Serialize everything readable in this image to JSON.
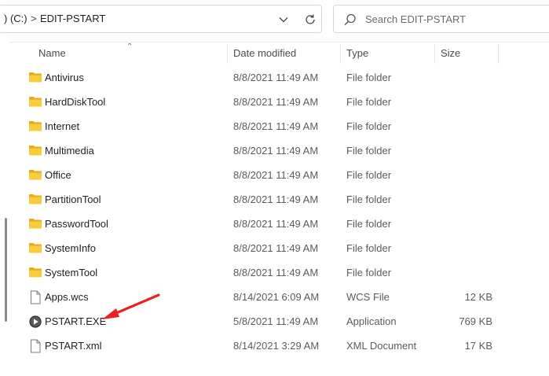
{
  "address": {
    "drive_label": ") (C:)",
    "separator": ">",
    "folder_label": "EDIT-PSTART"
  },
  "search": {
    "placeholder": "Search EDIT-PSTART"
  },
  "columns": {
    "name": "Name",
    "date": "Date modified",
    "type": "Type",
    "size": "Size"
  },
  "files": [
    {
      "name": "Antivirus",
      "date": "8/8/2021 11:49 AM",
      "type": "File folder",
      "size": "",
      "icon": "folder-icon"
    },
    {
      "name": "HardDiskTool",
      "date": "8/8/2021 11:49 AM",
      "type": "File folder",
      "size": "",
      "icon": "folder-icon"
    },
    {
      "name": "Internet",
      "date": "8/8/2021 11:49 AM",
      "type": "File folder",
      "size": "",
      "icon": "folder-icon"
    },
    {
      "name": "Multimedia",
      "date": "8/8/2021 11:49 AM",
      "type": "File folder",
      "size": "",
      "icon": "folder-icon"
    },
    {
      "name": "Office",
      "date": "8/8/2021 11:49 AM",
      "type": "File folder",
      "size": "",
      "icon": "folder-icon"
    },
    {
      "name": "PartitionTool",
      "date": "8/8/2021 11:49 AM",
      "type": "File folder",
      "size": "",
      "icon": "folder-icon"
    },
    {
      "name": "PasswordTool",
      "date": "8/8/2021 11:49 AM",
      "type": "File folder",
      "size": "",
      "icon": "folder-icon"
    },
    {
      "name": "SystemInfo",
      "date": "8/8/2021 11:49 AM",
      "type": "File folder",
      "size": "",
      "icon": "folder-icon"
    },
    {
      "name": "SystemTool",
      "date": "8/8/2021 11:49 AM",
      "type": "File folder",
      "size": "",
      "icon": "folder-icon"
    },
    {
      "name": "Apps.wcs",
      "date": "8/14/2021 6:09 AM",
      "type": "WCS File",
      "size": "12 KB",
      "icon": "document-icon"
    },
    {
      "name": "PSTART.EXE",
      "date": "5/8/2021 11:49 AM",
      "type": "Application",
      "size": "769 KB",
      "icon": "play-app-icon"
    },
    {
      "name": "PSTART.xml",
      "date": "8/14/2021 3:29 AM",
      "type": "XML Document",
      "size": "17 KB",
      "icon": "document-icon"
    }
  ],
  "colors": {
    "folder": "#f5c02b",
    "arrow": "#e8231f",
    "accent": "#0067c0"
  }
}
